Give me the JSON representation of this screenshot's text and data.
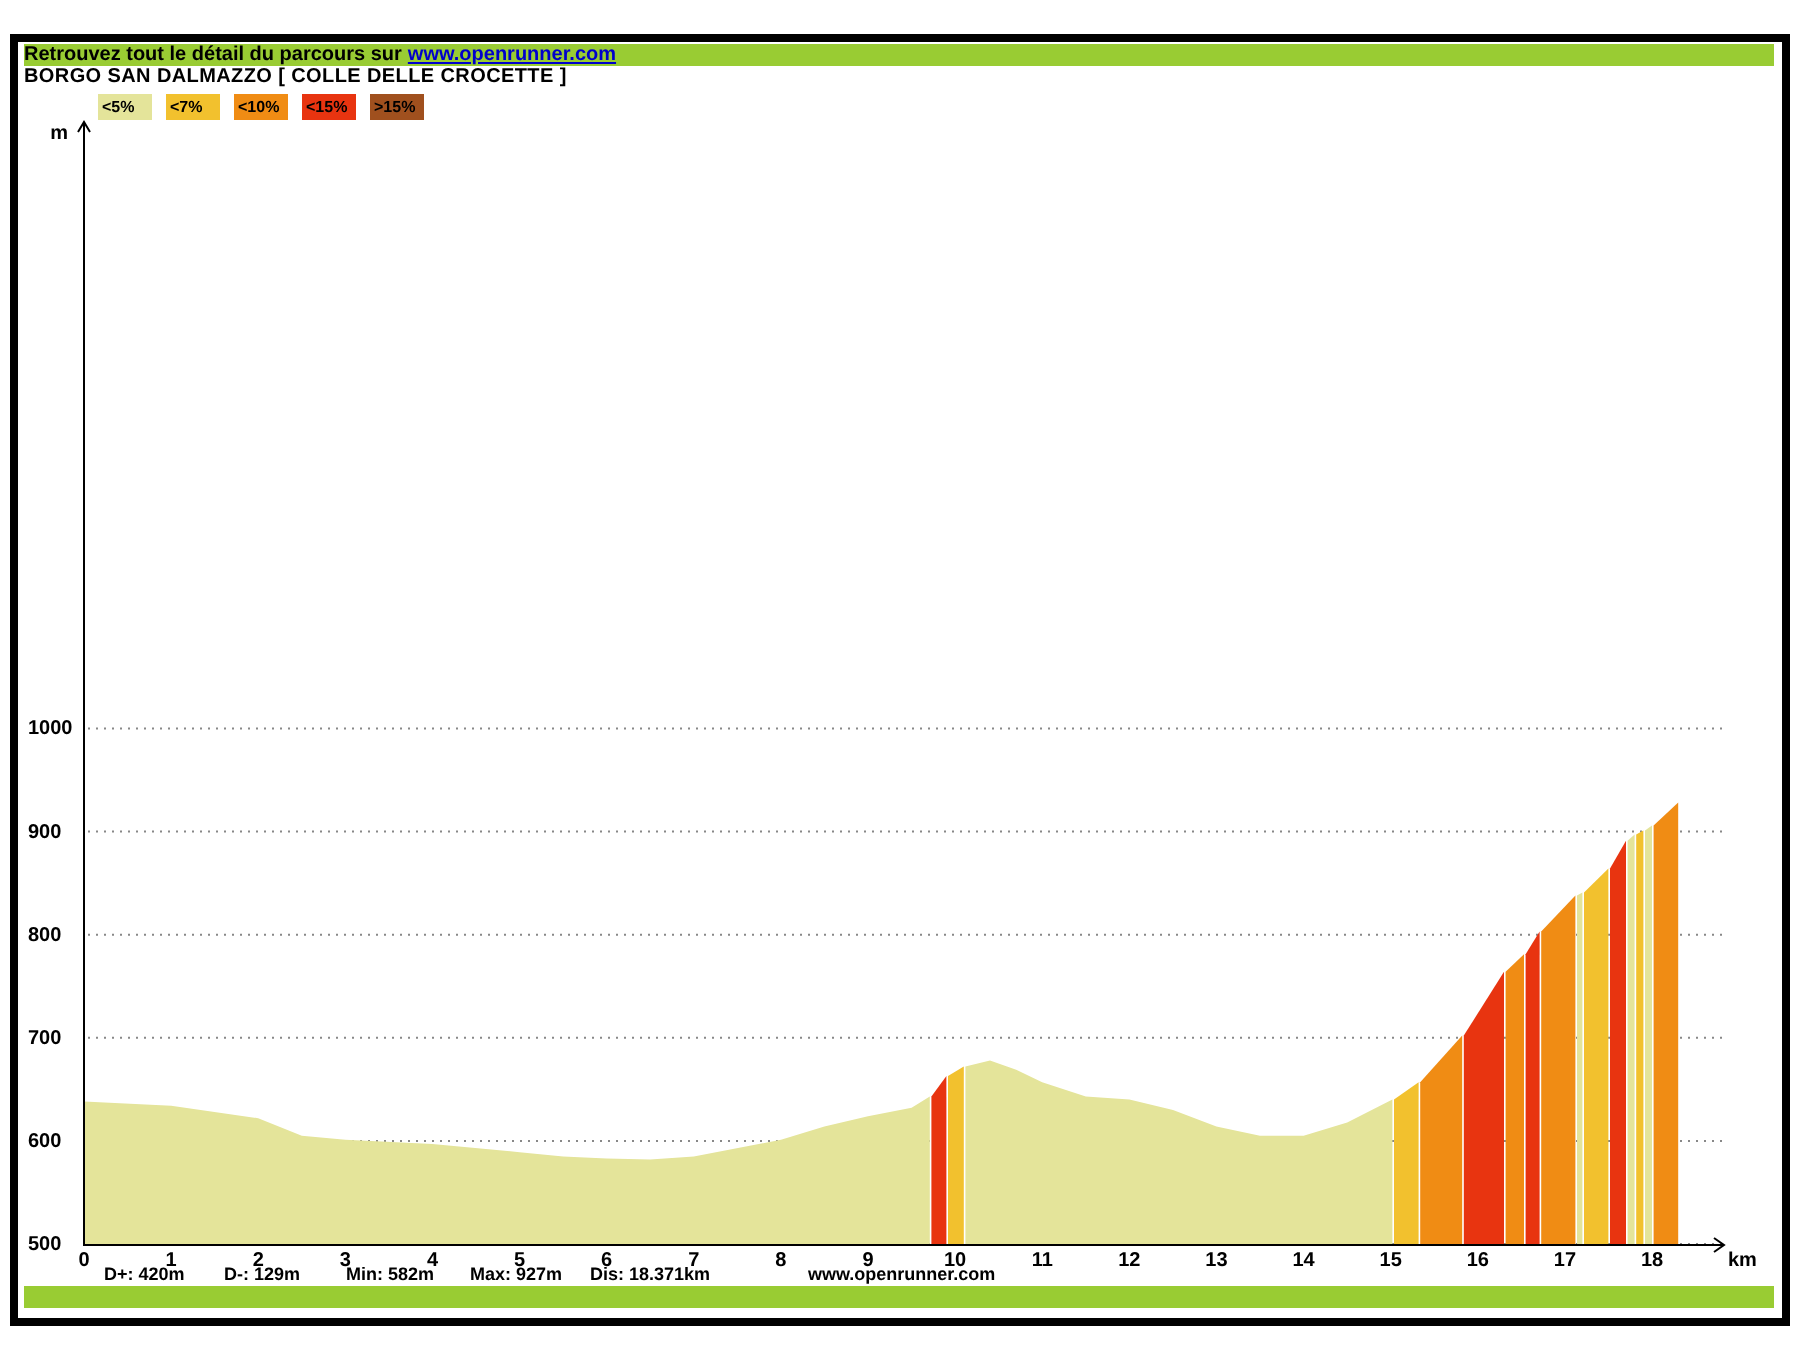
{
  "header": {
    "text": "Retrouvez tout le détail du parcours sur",
    "link": "www.openrunner.com"
  },
  "route_title": "BORGO SAN DALMAZZO [ COLLE DELLE CROCETTE ]",
  "profile": {
    "chart_data": {
      "type": "area",
      "grid": true,
      "xlabel": "km",
      "ylabel": "m",
      "xlim": [
        0,
        18.78
      ],
      "ylim": [
        500,
        1590
      ],
      "xticks": [
        0,
        1,
        2,
        3,
        4,
        5,
        6,
        7,
        8,
        9,
        10,
        11,
        12,
        13,
        14,
        15,
        16,
        17,
        18
      ],
      "yticks": [
        500,
        600,
        700,
        800,
        900,
        1000
      ],
      "x": [
        0,
        1,
        2,
        2.5,
        3,
        4,
        5,
        5.5,
        6,
        6.5,
        7,
        8,
        8.5,
        9,
        9.5,
        9.71,
        9.71,
        9.9,
        9.9,
        10.1,
        10.1,
        10.4,
        10.7,
        11,
        11.5,
        12,
        12.5,
        13,
        13.5,
        14,
        14.5,
        15.02,
        15.02,
        15.32,
        15.32,
        15.82,
        15.82,
        16.3,
        16.3,
        16.53,
        16.53,
        16.71,
        16.71,
        17.12,
        17.12,
        17.2,
        17.2,
        17.5,
        17.5,
        17.7,
        17.7,
        17.8,
        17.8,
        17.9,
        17.9,
        18.0,
        18.0,
        18.3
      ],
      "series": [
        {
          "name": "<5%",
          "color": "#e4e49a",
          "values": [
            638,
            634,
            622,
            605,
            601,
            597,
            589,
            585,
            583,
            582,
            585,
            601,
            614,
            624,
            632,
            643,
            null,
            null,
            null,
            null,
            672,
            678,
            669,
            657,
            643,
            640,
            630,
            614,
            605,
            605,
            618,
            640,
            null,
            null,
            null,
            null,
            null,
            null,
            null,
            null,
            null,
            null,
            null,
            null,
            838,
            841,
            null,
            null,
            null,
            null,
            891,
            897,
            null,
            null,
            901,
            906,
            null,
            null
          ]
        },
        {
          "name": "<7%",
          "color": "#f2c12e",
          "values": [
            null,
            null,
            null,
            null,
            null,
            null,
            null,
            null,
            null,
            null,
            null,
            null,
            null,
            null,
            null,
            null,
            null,
            null,
            663,
            672,
            null,
            null,
            null,
            null,
            null,
            null,
            null,
            null,
            null,
            null,
            null,
            null,
            640,
            657,
            null,
            null,
            null,
            null,
            null,
            null,
            null,
            null,
            null,
            null,
            null,
            null,
            841,
            864,
            null,
            null,
            null,
            null,
            897,
            901,
            null,
            null,
            null,
            null
          ]
        },
        {
          "name": "<10%",
          "color": "#f08c14",
          "values": [
            null,
            null,
            null,
            null,
            null,
            null,
            null,
            null,
            null,
            null,
            null,
            null,
            null,
            null,
            null,
            null,
            null,
            null,
            null,
            null,
            null,
            null,
            null,
            null,
            null,
            null,
            null,
            null,
            null,
            null,
            null,
            null,
            null,
            null,
            657,
            702,
            null,
            null,
            764,
            781,
            null,
            null,
            803,
            838,
            null,
            null,
            null,
            null,
            null,
            null,
            null,
            null,
            null,
            null,
            null,
            null,
            906,
            928
          ]
        },
        {
          "name": "<15%",
          "color": "#e83410",
          "values": [
            null,
            null,
            null,
            null,
            null,
            null,
            null,
            null,
            null,
            null,
            null,
            null,
            null,
            null,
            null,
            null,
            643,
            663,
            null,
            null,
            null,
            null,
            null,
            null,
            null,
            null,
            null,
            null,
            null,
            null,
            null,
            null,
            null,
            null,
            null,
            null,
            702,
            764,
            null,
            null,
            781,
            803,
            null,
            null,
            null,
            null,
            null,
            null,
            864,
            891,
            null,
            null,
            null,
            null,
            null,
            null,
            null,
            null
          ]
        },
        {
          "name": ">15%",
          "color": "#a0501e",
          "values": [
            null,
            null,
            null,
            null,
            null,
            null,
            null,
            null,
            null,
            null,
            null,
            null,
            null,
            null,
            null,
            null,
            null,
            null,
            null,
            null,
            null,
            null,
            null,
            null,
            null,
            null,
            null,
            null,
            null,
            null,
            null,
            null,
            null,
            null,
            null,
            null,
            null,
            null,
            null,
            null,
            null,
            null,
            null,
            null,
            null,
            null,
            null,
            null,
            null,
            null,
            null,
            null,
            null,
            null,
            null,
            null,
            null,
            null
          ]
        }
      ]
    }
  },
  "stats": [
    "D+: 420m",
    "D-: 129m",
    "Min: 582m",
    "Max: 927m",
    "Dis: 18.371km"
  ],
  "footer_link": "www.openrunner.com"
}
